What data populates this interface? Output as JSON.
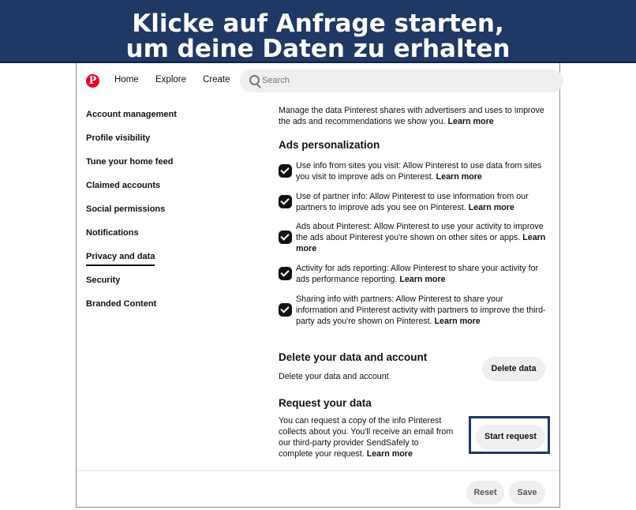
{
  "banner": {
    "line1": "Klicke auf Anfrage starten,",
    "line2": "um deine Daten zu erhalten"
  },
  "nav": {
    "logo_letter": "P",
    "home": "Home",
    "explore": "Explore",
    "create": "Create",
    "search_placeholder": "Search"
  },
  "sidebar": {
    "items": [
      {
        "label": "Account management",
        "active": false
      },
      {
        "label": "Profile visibility",
        "active": false
      },
      {
        "label": "Tune your home feed",
        "active": false
      },
      {
        "label": "Claimed accounts",
        "active": false
      },
      {
        "label": "Social permissions",
        "active": false
      },
      {
        "label": "Notifications",
        "active": false
      },
      {
        "label": "Privacy and data",
        "active": true
      },
      {
        "label": "Security",
        "active": false
      },
      {
        "label": "Branded Content",
        "active": false
      }
    ]
  },
  "intro": {
    "text": "Manage the data Pinterest shares with advertisers and uses to improve the ads and recommendations we show you.",
    "learn_more": "Learn more"
  },
  "ads": {
    "title": "Ads personalization",
    "options": [
      {
        "text": "Use info from sites you visit: Allow Pinterest to use data from sites you visit to improve ads on Pinterest.",
        "learn_more": "Learn more",
        "checked": true
      },
      {
        "text": "Use of partner info: Allow Pinterest to use information from our partners to improve ads you see on Pinterest.",
        "learn_more": "Learn more",
        "checked": true
      },
      {
        "text": "Ads about Pinterest: Allow Pinterest to use your activity to improve the ads about Pinterest you're shown on other sites or apps.",
        "learn_more": "Learn more",
        "checked": true
      },
      {
        "text": "Activity for ads reporting: Allow Pinterest to share your activity for ads performance reporting.",
        "learn_more": "Learn more",
        "checked": true
      },
      {
        "text": "Sharing info with partners: Allow Pinterest to share your information and Pinterest activity with partners to improve the third-party ads you're shown on Pinterest.",
        "learn_more": "Learn more",
        "checked": true
      }
    ]
  },
  "delete": {
    "title": "Delete your data and account",
    "description": "Delete your data and account",
    "button": "Delete data"
  },
  "request": {
    "title": "Request your data",
    "description": "You can request a copy of the info Pinterest collects about you. You'll receive an email from our third-party provider SendSafely to complete your request.",
    "learn_more": "Learn more",
    "button": "Start request"
  },
  "footer": {
    "reset": "Reset",
    "save": "Save"
  },
  "colors": {
    "brand": "#e60023",
    "banner": "#1f3864",
    "pill": "#efefef"
  }
}
